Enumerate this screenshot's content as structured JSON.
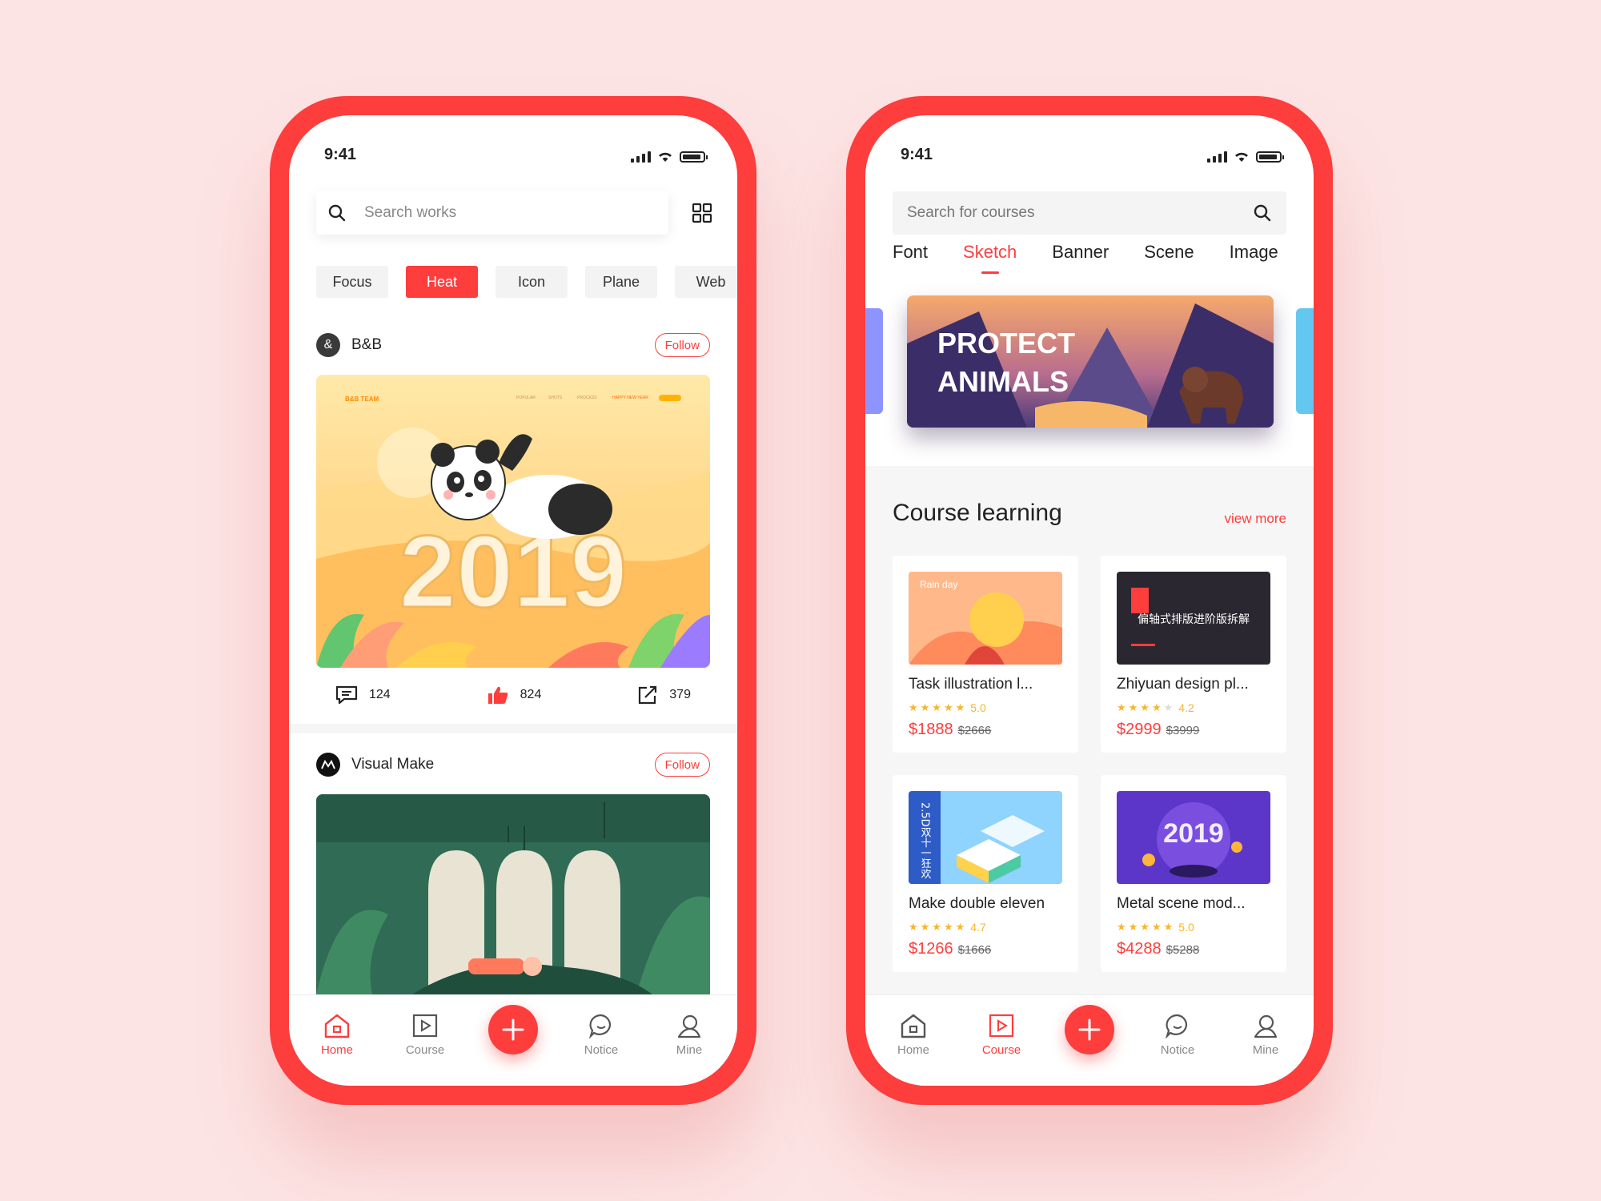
{
  "left_phone": {
    "status_time": "9:41",
    "search_placeholder": "Search works",
    "chips": [
      "Focus",
      "Heat",
      "Icon",
      "Plane",
      "Web"
    ],
    "active_chip": "Heat",
    "posts": [
      {
        "author": "B&B",
        "follow_label": "Follow",
        "image_caption": "2019",
        "image_header": {
          "brand": "B&B TEAM",
          "nav": [
            "POPULAR",
            "SHOTS",
            "PROCESS",
            "HAPPY NEW YEAR"
          ]
        },
        "comments": "124",
        "likes": "824",
        "shares": "379"
      },
      {
        "author": "Visual Make",
        "follow_label": "Follow"
      }
    ],
    "tabbar": {
      "home": "Home",
      "course": "Course",
      "notice": "Notice",
      "mine": "Mine",
      "active": "Home"
    }
  },
  "right_phone": {
    "status_time": "9:41",
    "search_placeholder": "Search for courses",
    "categories": [
      "Font",
      "Sketch",
      "Banner",
      "Scene",
      "Image"
    ],
    "active_category": "Sketch",
    "banner_text_1": "PROTECT",
    "banner_text_2": "ANIMALS",
    "section_title": "Course learning",
    "view_more": "view more",
    "courses": [
      {
        "title": "Task illustration l...",
        "rating": "5.0",
        "stars": 5,
        "price": "$1888",
        "old_price": "$2666",
        "thumb_label": "Rain day"
      },
      {
        "title": "Zhiyuan design pl...",
        "rating": "4.2",
        "stars": 4,
        "price": "$2999",
        "old_price": "$3999",
        "thumb_label": "偏轴式排版进阶版拆解"
      },
      {
        "title": "Make double eleven",
        "rating": "4.7",
        "stars": 5,
        "price": "$1266",
        "old_price": "$1666",
        "thumb_label": "2.5D双十一狂欢"
      },
      {
        "title": "Metal scene mod...",
        "rating": "5.0",
        "stars": 5,
        "price": "$4288",
        "old_price": "$5288",
        "thumb_label": "2019"
      }
    ],
    "tabbar": {
      "home": "Home",
      "course": "Course",
      "notice": "Notice",
      "mine": "Mine",
      "active": "Course"
    }
  },
  "colors": {
    "accent": "#fe3d3d",
    "background": "#fce4e4",
    "star": "#f9b52b"
  }
}
